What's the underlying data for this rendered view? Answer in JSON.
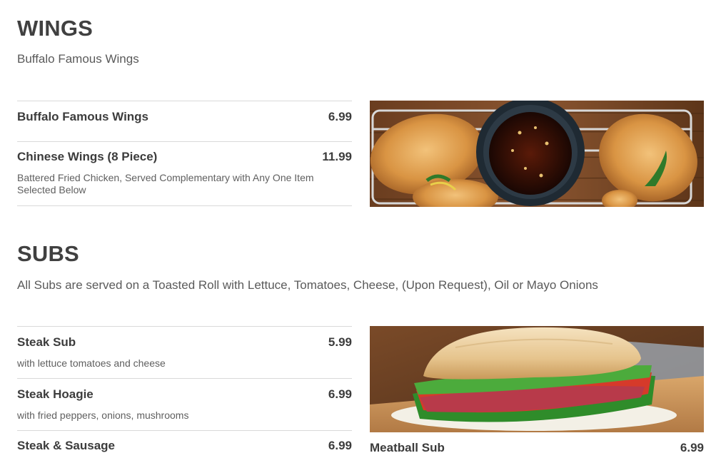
{
  "wings": {
    "title": "WINGS",
    "description": "Buffalo Famous Wings",
    "items": [
      {
        "name": "Buffalo Famous Wings",
        "price": "6.99",
        "description": ""
      },
      {
        "name": "Chinese Wings (8 Piece)",
        "price": "11.99",
        "description": "Battered Fried Chicken, Served Complementary with Any One Item Selected Below"
      }
    ]
  },
  "subs": {
    "title": "SUBS",
    "description": "All Subs are served on a Toasted Roll with Lettuce, Tomatoes, Cheese, (Upon Request), Oil or Mayo Onions",
    "items": [
      {
        "name": "Steak Sub",
        "price": "5.99",
        "description": "with lettuce tomatoes and cheese"
      },
      {
        "name": "Steak Hoagie",
        "price": "6.99",
        "description": "with fried peppers, onions, mushrooms"
      },
      {
        "name": "Steak & Sausage",
        "price": "6.99",
        "description": ""
      }
    ],
    "featured": {
      "name": "Meatball Sub",
      "price": "6.99"
    }
  }
}
